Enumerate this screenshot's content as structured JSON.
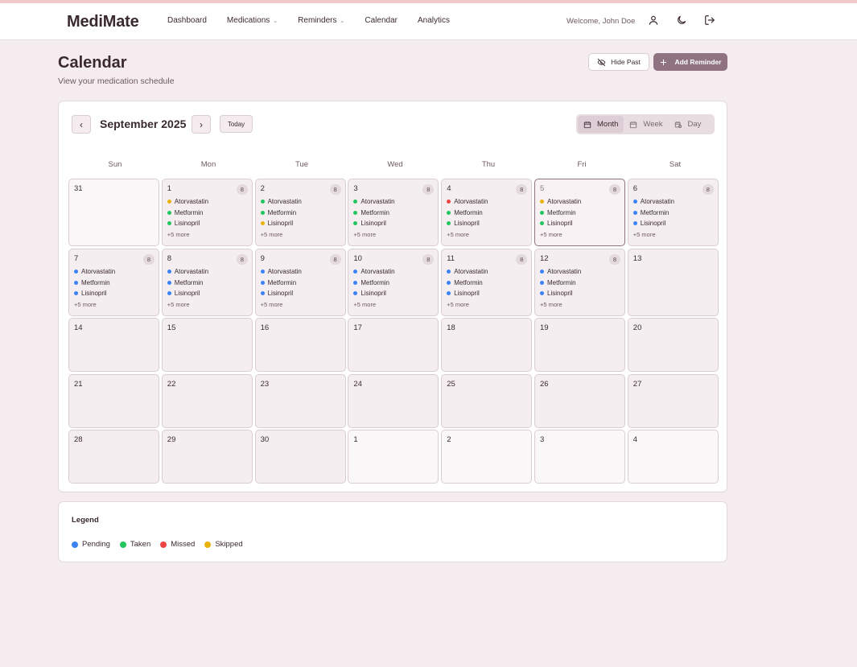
{
  "app": {
    "brand": "MediMate",
    "nav": [
      {
        "label": "Dashboard",
        "has_dropdown": false
      },
      {
        "label": "Medications",
        "has_dropdown": true
      },
      {
        "label": "Reminders",
        "has_dropdown": true
      },
      {
        "label": "Calendar",
        "has_dropdown": false
      },
      {
        "label": "Analytics",
        "has_dropdown": false
      }
    ],
    "welcome": "Welcome, John Doe",
    "header_icons": [
      "user-icon",
      "moon-icon",
      "logout-icon"
    ]
  },
  "page": {
    "title": "Calendar",
    "subtitle": "View your medication schedule",
    "hide_past_label": "Hide Past",
    "add_reminder_label": "Add Reminder"
  },
  "calendar": {
    "month_label": "September 2025",
    "today_label": "Today",
    "views": [
      {
        "label": "Month",
        "active": true,
        "icon": "calendar-icon"
      },
      {
        "label": "Week",
        "active": false,
        "icon": "calendar-icon"
      },
      {
        "label": "Day",
        "active": false,
        "icon": "calendar-clock-icon"
      }
    ],
    "weekdays": [
      "Sun",
      "Mon",
      "Tue",
      "Wed",
      "Thu",
      "Fri",
      "Sat"
    ],
    "weeks": [
      [
        {
          "day": "31",
          "outside": true
        },
        {
          "day": "1",
          "count": "8",
          "meds": [
            [
              "Atorvastatin",
              "skipped"
            ],
            [
              "Metformin",
              "taken"
            ],
            [
              "Lisinopril",
              "taken"
            ]
          ],
          "more": "+5 more"
        },
        {
          "day": "2",
          "count": "8",
          "meds": [
            [
              "Atorvastatin",
              "taken"
            ],
            [
              "Metformin",
              "taken"
            ],
            [
              "Lisinopril",
              "skipped"
            ]
          ],
          "more": "+5 more"
        },
        {
          "day": "3",
          "count": "8",
          "meds": [
            [
              "Atorvastatin",
              "taken"
            ],
            [
              "Metformin",
              "taken"
            ],
            [
              "Lisinopril",
              "taken"
            ]
          ],
          "more": "+5 more"
        },
        {
          "day": "4",
          "count": "8",
          "meds": [
            [
              "Atorvastatin",
              "missed"
            ],
            [
              "Metformin",
              "taken"
            ],
            [
              "Lisinopril",
              "taken"
            ]
          ],
          "more": "+5 more"
        },
        {
          "day": "5",
          "count": "8",
          "today": true,
          "meds": [
            [
              "Atorvastatin",
              "skipped"
            ],
            [
              "Metformin",
              "taken"
            ],
            [
              "Lisinopril",
              "taken"
            ]
          ],
          "more": "+5 more"
        },
        {
          "day": "6",
          "count": "8",
          "meds": [
            [
              "Atorvastatin",
              "pending"
            ],
            [
              "Metformin",
              "pending"
            ],
            [
              "Lisinopril",
              "pending"
            ]
          ],
          "more": "+5 more"
        }
      ],
      [
        {
          "day": "7",
          "count": "8",
          "meds": [
            [
              "Atorvastatin",
              "pending"
            ],
            [
              "Metformin",
              "pending"
            ],
            [
              "Lisinopril",
              "pending"
            ]
          ],
          "more": "+5 more"
        },
        {
          "day": "8",
          "count": "8",
          "meds": [
            [
              "Atorvastatin",
              "pending"
            ],
            [
              "Metformin",
              "pending"
            ],
            [
              "Lisinopril",
              "pending"
            ]
          ],
          "more": "+5 more"
        },
        {
          "day": "9",
          "count": "8",
          "meds": [
            [
              "Atorvastatin",
              "pending"
            ],
            [
              "Metformin",
              "pending"
            ],
            [
              "Lisinopril",
              "pending"
            ]
          ],
          "more": "+5 more"
        },
        {
          "day": "10",
          "count": "8",
          "meds": [
            [
              "Atorvastatin",
              "pending"
            ],
            [
              "Metformin",
              "pending"
            ],
            [
              "Lisinopril",
              "pending"
            ]
          ],
          "more": "+5 more"
        },
        {
          "day": "11",
          "count": "8",
          "meds": [
            [
              "Atorvastatin",
              "pending"
            ],
            [
              "Metformin",
              "pending"
            ],
            [
              "Lisinopril",
              "pending"
            ]
          ],
          "more": "+5 more"
        },
        {
          "day": "12",
          "count": "8",
          "meds": [
            [
              "Atorvastatin",
              "pending"
            ],
            [
              "Metformin",
              "pending"
            ],
            [
              "Lisinopril",
              "pending"
            ]
          ],
          "more": "+5 more"
        },
        {
          "day": "13"
        }
      ],
      [
        {
          "day": "14"
        },
        {
          "day": "15"
        },
        {
          "day": "16"
        },
        {
          "day": "17"
        },
        {
          "day": "18"
        },
        {
          "day": "19"
        },
        {
          "day": "20"
        }
      ],
      [
        {
          "day": "21"
        },
        {
          "day": "22"
        },
        {
          "day": "23"
        },
        {
          "day": "24"
        },
        {
          "day": "25"
        },
        {
          "day": "26"
        },
        {
          "day": "27"
        }
      ],
      [
        {
          "day": "28"
        },
        {
          "day": "29"
        },
        {
          "day": "30"
        },
        {
          "day": "1",
          "outside": true
        },
        {
          "day": "2",
          "outside": true
        },
        {
          "day": "3",
          "outside": true
        },
        {
          "day": "4",
          "outside": true
        }
      ]
    ]
  },
  "status_colors": {
    "pending": "#3b82f6",
    "taken": "#22c55e",
    "missed": "#ef4444",
    "skipped": "#eab308"
  },
  "legend": {
    "title": "Legend",
    "items": [
      {
        "label": "Pending",
        "status": "pending"
      },
      {
        "label": "Taken",
        "status": "taken"
      },
      {
        "label": "Missed",
        "status": "missed"
      },
      {
        "label": "Skipped",
        "status": "skipped"
      }
    ]
  }
}
